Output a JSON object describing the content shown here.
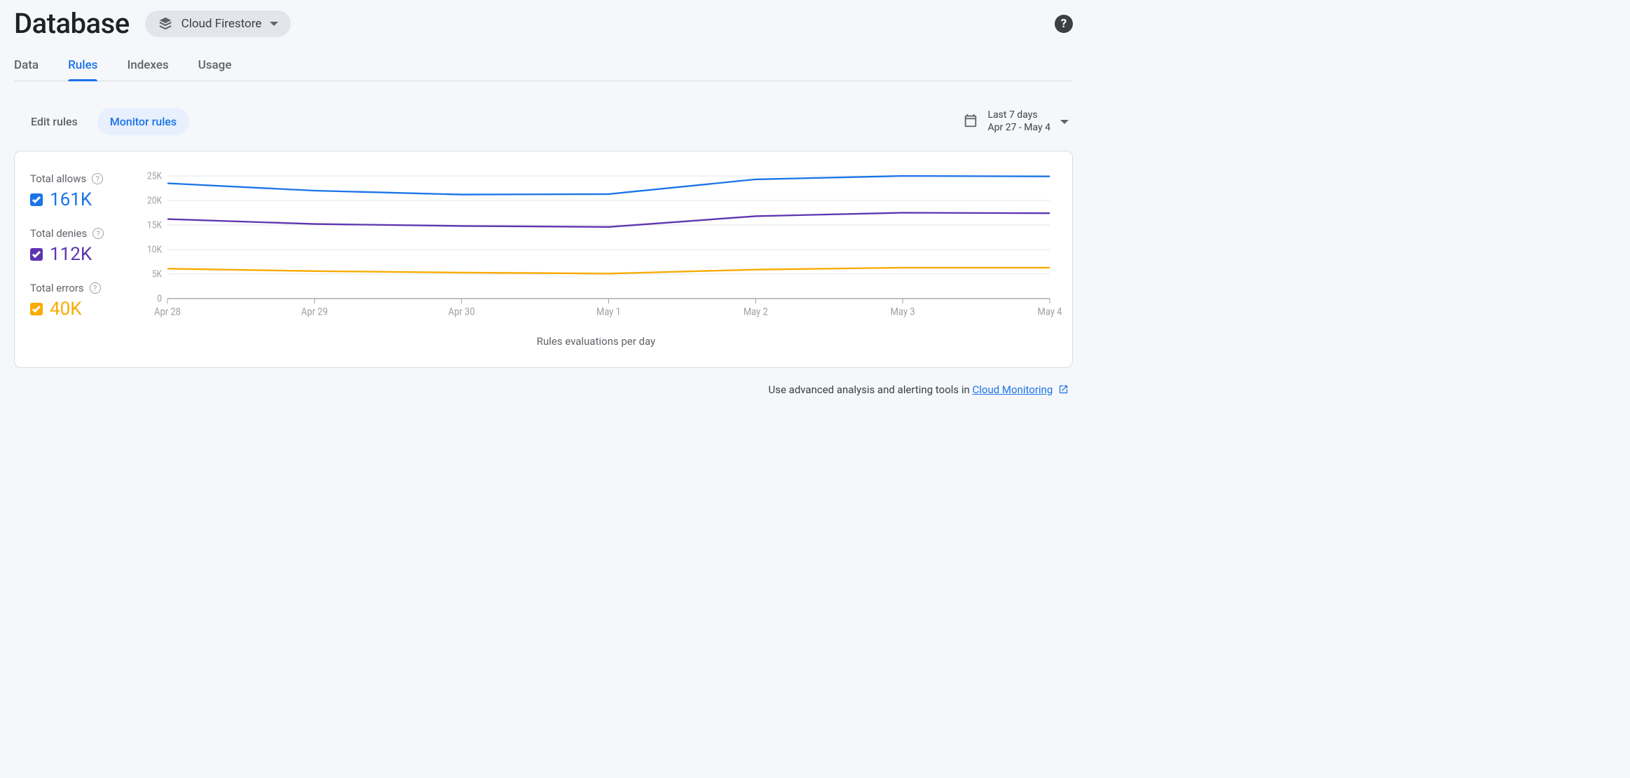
{
  "header": {
    "title": "Database",
    "db_selector_label": "Cloud Firestore"
  },
  "tabs": {
    "items": [
      "Data",
      "Rules",
      "Indexes",
      "Usage"
    ],
    "active_index": 1
  },
  "subtabs": {
    "items": [
      "Edit rules",
      "Monitor rules"
    ],
    "active_index": 1
  },
  "date_range": {
    "label": "Last 7 days",
    "range": "Apr 27 - May 4"
  },
  "legend": {
    "allows": {
      "label": "Total allows",
      "value": "161K"
    },
    "denies": {
      "label": "Total denies",
      "value": "112K"
    },
    "errors": {
      "label": "Total errors",
      "value": "40K"
    }
  },
  "footer": {
    "prefix": "Use advanced analysis and alerting tools in ",
    "link_text": "Cloud Monitoring"
  },
  "chart_data": {
    "type": "line",
    "xlabel": "Rules evaluations per day",
    "ylabel": "",
    "ylim": [
      0,
      25000
    ],
    "y_ticks": [
      0,
      5000,
      10000,
      15000,
      20000,
      25000
    ],
    "y_tick_labels": [
      "0",
      "5K",
      "10K",
      "15K",
      "20K",
      "25K"
    ],
    "categories": [
      "Apr 28",
      "Apr 29",
      "Apr 30",
      "May 1",
      "May 2",
      "May 3",
      "May 4"
    ],
    "series": [
      {
        "name": "allows",
        "color": "#1a73e8",
        "values": [
          23500,
          22000,
          21200,
          21300,
          24300,
          25000,
          24900
        ]
      },
      {
        "name": "denies",
        "color": "#5e35b1",
        "values": [
          16200,
          15200,
          14800,
          14600,
          16800,
          17500,
          17400
        ]
      },
      {
        "name": "errors",
        "color": "#f9ab00",
        "values": [
          6100,
          5600,
          5300,
          5100,
          5900,
          6300,
          6300
        ]
      }
    ]
  }
}
